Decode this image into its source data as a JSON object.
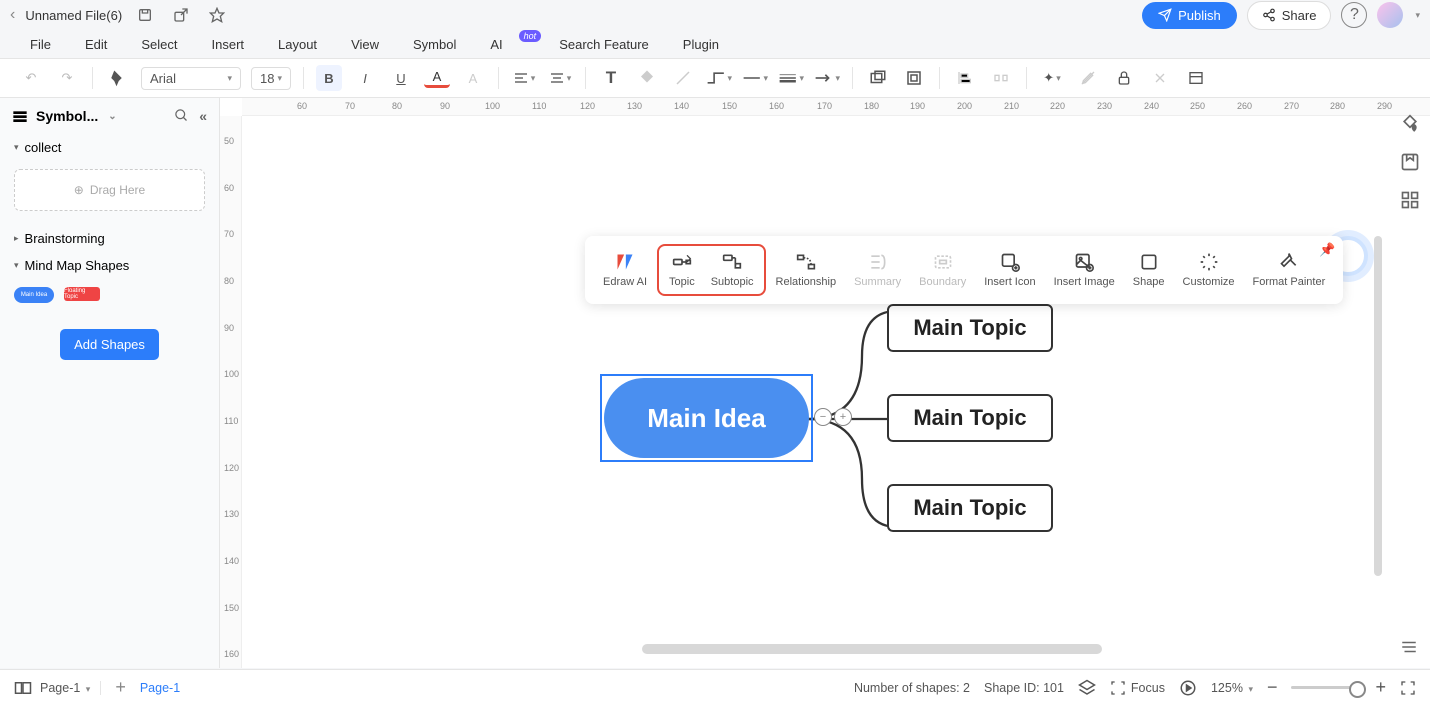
{
  "header": {
    "file_title": "Unnamed File(6)",
    "publish": "Publish",
    "share": "Share"
  },
  "menu": [
    "File",
    "Edit",
    "Select",
    "Insert",
    "Layout",
    "View",
    "Symbol",
    "AI",
    "Search Feature",
    "Plugin"
  ],
  "hot_badge": "hot",
  "toolbar": {
    "font": "Arial",
    "size": "18"
  },
  "sidebar": {
    "title": "Symbol...",
    "sections": {
      "collect": "collect",
      "drag_here": "Drag Here",
      "brainstorming": "Brainstorming",
      "mindmap_shapes": "Mind Map Shapes",
      "add_shapes": "Add Shapes"
    }
  },
  "ruler_h": [
    "60",
    "70",
    "80",
    "90",
    "100",
    "110",
    "120",
    "130",
    "140",
    "150",
    "160",
    "170",
    "180",
    "190",
    "200",
    "210",
    "220",
    "230",
    "240",
    "250",
    "260",
    "270",
    "280",
    "290"
  ],
  "ruler_v": [
    "50",
    "60",
    "70",
    "80",
    "90",
    "100",
    "110",
    "120",
    "130",
    "140",
    "150",
    "160"
  ],
  "float_tools": {
    "edraw_ai": "Edraw AI",
    "topic": "Topic",
    "subtopic": "Subtopic",
    "relationship": "Relationship",
    "summary": "Summary",
    "boundary": "Boundary",
    "insert_icon": "Insert Icon",
    "insert_image": "Insert Image",
    "shape": "Shape",
    "customize": "Customize",
    "format_painter": "Format Painter"
  },
  "mindmap": {
    "main_idea": "Main Idea",
    "topics": [
      "Main Topic",
      "Main Topic",
      "Main Topic"
    ]
  },
  "status": {
    "page_name": "Page-1",
    "page_tab": "Page-1",
    "shapes_count": "Number of shapes: 2",
    "shape_id": "Shape ID: 101",
    "focus": "Focus",
    "zoom": "125%"
  }
}
